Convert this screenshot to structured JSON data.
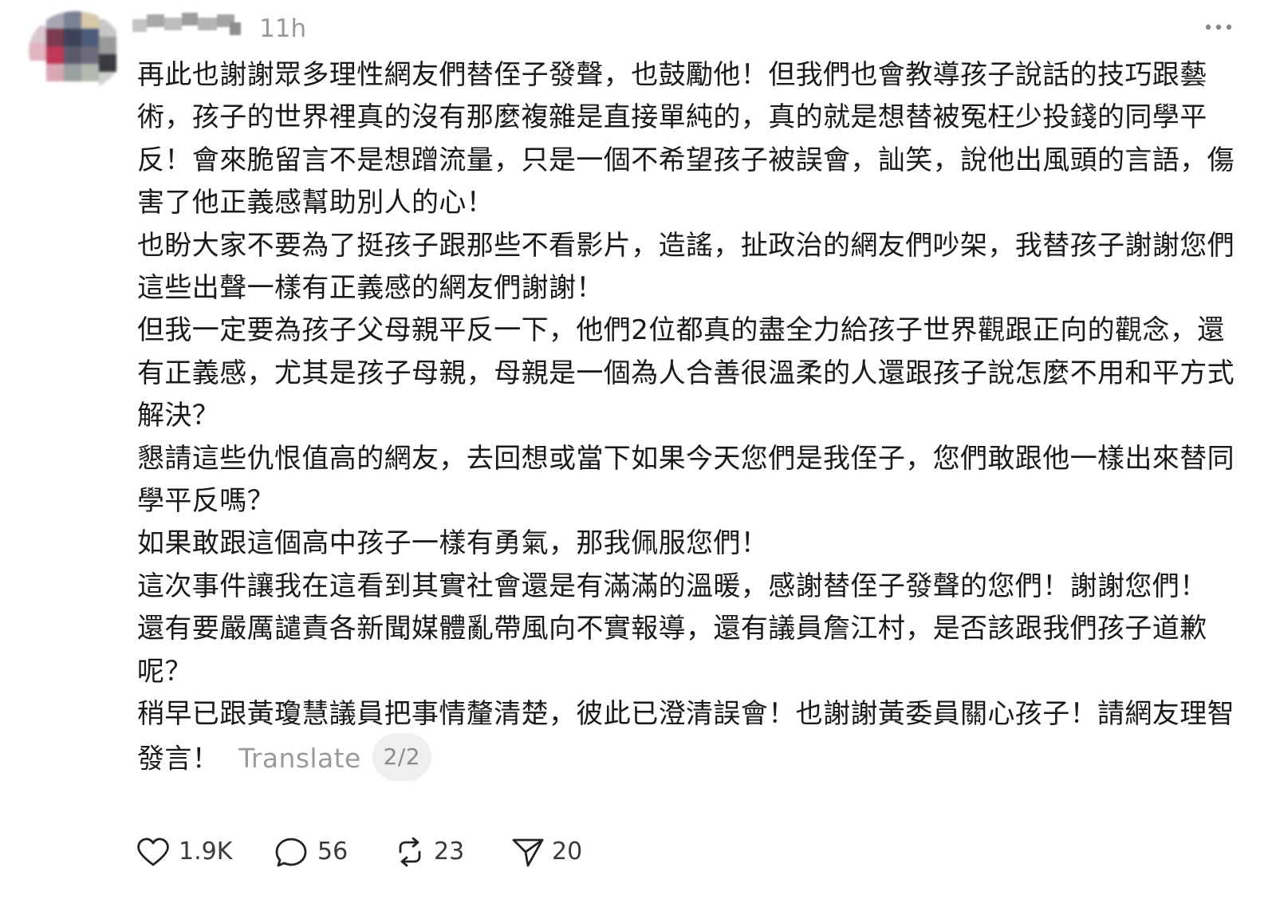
{
  "post": {
    "timestamp": "11h",
    "paragraphs": [
      "再此也謝謝眾多理性網友們替侄子發聲，也鼓勵他！但我們也會教導孩子說話的技巧跟藝術，孩子的世界裡真的沒有那麼複雜是直接單純的，真的就是想替被冤枉少投錢的同學平反！會來脆留言不是想蹭流量，只是一個不希望孩子被誤會，訕笑，說他出風頭的言語，傷害了他正義感幫助別人的心！",
      "也盼大家不要為了挺孩子跟那些不看影片，造謠，扯政治的網友們吵架，我替孩子謝謝您們這些出聲一樣有正義感的網友們謝謝！",
      "但我一定要為孩子父母親平反一下，他們2位都真的盡全力給孩子世界觀跟正向的觀念，還有正義感，尤其是孩子母親，母親是一個為人合善很溫柔的人還跟孩子說怎麼不用和平方式解決？",
      "懇請這些仇恨值高的網友，去回想或當下如果今天您們是我侄子，您們敢跟他一樣出來替同學平反嗎？",
      "如果敢跟這個高中孩子一樣有勇氣，那我佩服您們！",
      "這次事件讓我在這看到其實社會還是有滿滿的溫暖，感謝替侄子發聲的您們！謝謝您們！",
      "還有要嚴厲譴責各新聞媒體亂帶風向不實報導，還有議員詹江村，是否該跟我們孩子道歉呢？",
      "稍早已跟黃瓊慧議員把事情釐清楚，彼此已澄清誤會！也謝謝黃委員關心孩子！請網友理智發言！"
    ],
    "translate_label": "Translate",
    "page_indicator": "2/2"
  },
  "actions": {
    "likes": "1.9K",
    "comments": "56",
    "reposts": "23",
    "shares": "20"
  },
  "icons": {
    "avatar": "avatar-icon",
    "more": "more-options-icon",
    "like": "heart-icon",
    "comment": "comment-bubble-icon",
    "repost": "repost-icon",
    "share": "send-icon"
  }
}
